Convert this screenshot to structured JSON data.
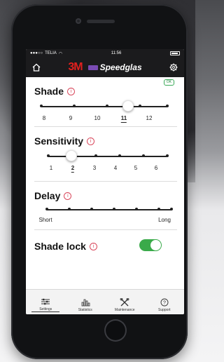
{
  "status_bar": {
    "carrier": "TELIA",
    "time": "11:56"
  },
  "app_bar": {
    "brand_3m": "3M",
    "brand_name": "Speedglas",
    "brand_color": "#e1201e",
    "accent_purple": "#7a4bb3"
  },
  "ok_badge": "OK",
  "shade": {
    "title": "Shade",
    "labels": [
      "8",
      "9",
      "10",
      "11",
      "12"
    ],
    "selected": "11"
  },
  "sensitivity": {
    "title": "Sensitivity",
    "labels": [
      "1",
      "2",
      "3",
      "4",
      "5",
      "6"
    ],
    "selected": "2"
  },
  "delay": {
    "title": "Delay",
    "min_label": "Short",
    "max_label": "Long",
    "steps": 7,
    "selected_index": null
  },
  "shade_lock": {
    "title": "Shade lock",
    "enabled": true,
    "on_color": "#3aaa4a"
  },
  "tabs": [
    {
      "label": "Settings",
      "icon": "sliders-icon",
      "active": true
    },
    {
      "label": "Statistics",
      "icon": "bar-chart-icon",
      "active": false
    },
    {
      "label": "Maintenance",
      "icon": "tools-icon",
      "active": false
    },
    {
      "label": "Support",
      "icon": "question-icon",
      "active": false
    }
  ]
}
